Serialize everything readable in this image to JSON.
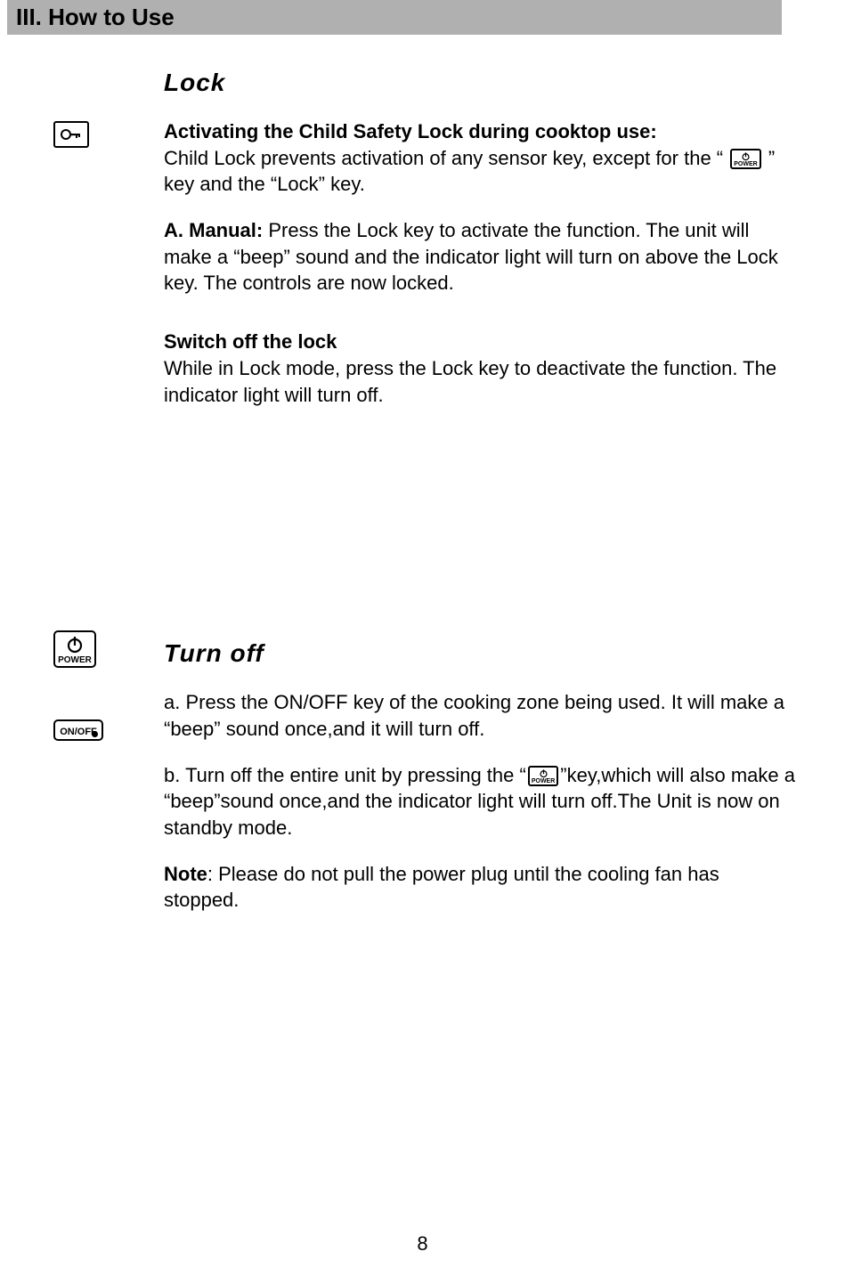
{
  "header": "III.  How to Use",
  "lock": {
    "title": " Lock",
    "h_activate": "Activating the Child Safety Lock during cooktop use:",
    "p_childlock_1": "Child Lock prevents activation of any sensor key, except for the “ ",
    "p_childlock_2": " ” key and the “Lock” key.",
    "h_manual": "A. Manual: ",
    "p_manual": "Press the Lock key to activate the function. The unit will make a “beep” sound and the indicator light will turn on above the Lock key. The controls are now locked.",
    "h_switchoff": "Switch off the lock",
    "p_switchoff": "While in Lock mode, press the Lock key to deactivate the function. The indicator light will turn off."
  },
  "turnoff": {
    "title": "Turn off",
    "p_a": "a. Press the ON/OFF key of the cooking zone being used. It will make a “beep” sound once,and it will turn off.",
    "p_b_1": "b. Turn off the entire unit by pressing the “",
    "p_b_2": "”key,which will  also make a “beep”sound once,and the indicator light will turn off.The Unit is now on standby mode.",
    "h_note": "Note",
    "p_note": ": Please do not pull the power plug until the cooling fan has stopped."
  },
  "labels": {
    "power": "POWER",
    "onoff": "ON/OFF"
  },
  "page_number": "8"
}
